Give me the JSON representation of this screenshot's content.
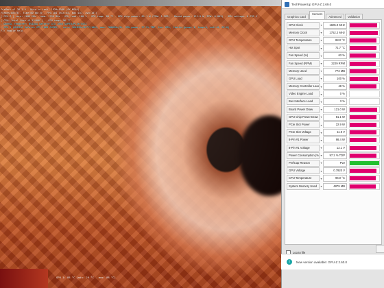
{
  "app": {
    "title": "TechPowerUp GPU-Z 2.69.0"
  },
  "tabs": [
    {
      "label": "Graphics Card",
      "active": false
    },
    {
      "label": "Sensors",
      "active": true
    },
    {
      "label": "Advanced",
      "active": false
    },
    {
      "label": "Validation",
      "active": false
    }
  ],
  "sensors": [
    {
      "label": "GPU Clock",
      "value": "1605.0 MHz",
      "fill": 0.92,
      "color": "#e0006e"
    },
    {
      "label": "Memory Clock",
      "value": "1752.2 MHz",
      "fill": 0.95,
      "color": "#e0006e"
    },
    {
      "label": "GPU Temperature",
      "value": "88.0 °C",
      "fill": 0.9,
      "color": "#e0006e"
    },
    {
      "label": "Hot Spot",
      "value": "71.7 °C",
      "fill": 0.9,
      "color": "#e0006e"
    },
    {
      "label": "Fan Speed (%)",
      "value": "63 %",
      "fill": 0.88,
      "color": "#e0006e"
    },
    {
      "label": "Fan Speed (RPM)",
      "value": "2229 RPM",
      "fill": 0.88,
      "color": "#e0006e"
    },
    {
      "label": "Memory Used",
      "value": "773 MB",
      "fill": 0.9,
      "color": "#e0006e"
    },
    {
      "label": "GPU Load",
      "value": "100 %",
      "fill": 0.95,
      "color": "#e0006e"
    },
    {
      "label": "Memory Controller Load",
      "value": "48 %",
      "fill": 0.9,
      "color": "#e0006e"
    },
    {
      "label": "Video Engine Load",
      "value": "0 %",
      "fill": 0.0,
      "color": "#e0006e"
    },
    {
      "label": "Bus Interface Load",
      "value": "3 %",
      "fill": 0.0,
      "color": "#e0006e"
    },
    {
      "label": "Board Power Draw",
      "value": "121.0 W",
      "fill": 0.92,
      "color": "#e0006e"
    },
    {
      "label": "GPU Chip Power Draw",
      "value": "81.1 W",
      "fill": 0.9,
      "color": "#e0006e"
    },
    {
      "label": "PCIe Slot Power",
      "value": "22.9 W",
      "fill": 0.9,
      "color": "#e0006e"
    },
    {
      "label": "PCIe Slot Voltage",
      "value": "11.9 V",
      "fill": 0.9,
      "color": "#e0006e"
    },
    {
      "label": "8-Pin #1 Power",
      "value": "98.4 W",
      "fill": 0.9,
      "color": "#e0006e"
    },
    {
      "label": "8-Pin #1 Voltage",
      "value": "12.1 V",
      "fill": 0.9,
      "color": "#e0006e"
    },
    {
      "label": "Power Consumption (%)",
      "value": "97.2 % TDP",
      "fill": 0.9,
      "color": "#e0006e"
    },
    {
      "label": "PerfCap Reason",
      "value": "Pwr",
      "fill": 1.0,
      "color": "#22c02e"
    },
    {
      "label": "GPU Voltage",
      "value": "0.7920 V",
      "fill": 0.9,
      "color": "#e0006e"
    },
    {
      "label": "CPU Temperature",
      "value": "96.0 °C",
      "fill": 0.88,
      "color": "#e0006e"
    },
    {
      "label": "System Memory Used",
      "value": "4879 MB",
      "fill": 0.88,
      "color": "#e0006e"
    }
  ],
  "log_to_file": {
    "label": "Log to file",
    "checked": false
  },
  "device": {
    "selected": "NVIDIA GeForce GTX 1660 SUPER",
    "close_label": "Close"
  },
  "update": {
    "icon": "info-icon",
    "text": "New version available: GPU-Z 2.60.0"
  },
  "overlay": {
    "title_line": "FurMark v1.38.1.0 - Burn-in test, 1920x1080 (8X MSAA)",
    "line2": "Frames:88570 - time:00:08:19 - FPS:184 (min:85, max:187, avg:187)",
    "line3": "[ GPU-Z ] core: 1605 MHz - mem: 1750 MHz - GPU load: 100 % - GPU temp: 88 °C - GPU chip power: 81.1 W (PPW: 1.283) - Board power: 121.0 W (PPW: 0.863) - GPU voltage: 0.792 V",
    "line4": "[ CPU: Intel Core i5-12400F ] - CPU temp: 96 °C",
    "line5": "- OpenGL renderer: NVIDIA GeForce GTX 1660 SUPER/PCIe/SSE2",
    "line6": "- GPU 1 (NVIDIA GeForce GTX 1660 SUPER) - core: 1605MHz/88°C/100%, mem: 7004MHz/3%, GPU power: 97.2% TDP, fan: 63%, limits:[power:1, temp:0, volt:0, OV:0]",
    "line7": "F1: toggle help",
    "bottom_status": "GPU 1: 88 °C (min: 29 °C - max: 88 °C)"
  }
}
